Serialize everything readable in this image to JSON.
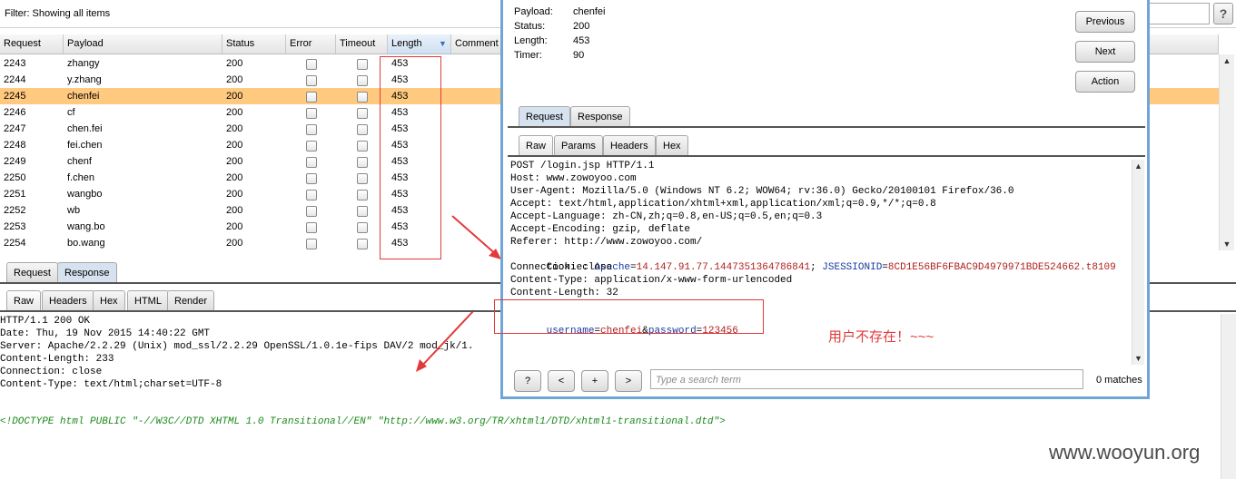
{
  "filter": {
    "label": "Filter: Showing all items",
    "help": "?"
  },
  "table": {
    "columns": [
      "Request",
      "Payload",
      "Status",
      "Error",
      "Timeout",
      "Length",
      "Comment"
    ],
    "sort_indicator": "▼",
    "rows": [
      {
        "request": "2243",
        "payload": "zhangy",
        "status": "200",
        "length": "453"
      },
      {
        "request": "2244",
        "payload": "y.zhang",
        "status": "200",
        "length": "453"
      },
      {
        "request": "2245",
        "payload": "chenfei",
        "status": "200",
        "length": "453",
        "selected": true
      },
      {
        "request": "2246",
        "payload": "cf",
        "status": "200",
        "length": "453"
      },
      {
        "request": "2247",
        "payload": "chen.fei",
        "status": "200",
        "length": "453"
      },
      {
        "request": "2248",
        "payload": "fei.chen",
        "status": "200",
        "length": "453"
      },
      {
        "request": "2249",
        "payload": "chenf",
        "status": "200",
        "length": "453"
      },
      {
        "request": "2250",
        "payload": "f.chen",
        "status": "200",
        "length": "453"
      },
      {
        "request": "2251",
        "payload": "wangbo",
        "status": "200",
        "length": "453"
      },
      {
        "request": "2252",
        "payload": "wb",
        "status": "200",
        "length": "453"
      },
      {
        "request": "2253",
        "payload": "wang.bo",
        "status": "200",
        "length": "453"
      },
      {
        "request": "2254",
        "payload": "bo.wang",
        "status": "200",
        "length": "453"
      }
    ]
  },
  "bottom_tabs": {
    "request": "Request",
    "response": "Response"
  },
  "view_tabs": {
    "raw": "Raw",
    "headers": "Headers",
    "hex": "Hex",
    "html": "HTML",
    "render": "Render"
  },
  "response_lines": [
    "HTTP/1.1 200 OK",
    "Date: Thu, 19 Nov 2015 14:40:22 GMT",
    "Server: Apache/2.2.29 (Unix) mod_ssl/2.2.29 OpenSSL/1.0.1e-fips DAV/2 mod_jk/1.",
    "Content-Length: 233",
    "Connection: close",
    "Content-Type: text/html;charset=UTF-8"
  ],
  "doctype_line": "<!DOCTYPE html PUBLIC \"-//W3C//DTD XHTML 1.0 Transitional//EN\" \"http://www.w3.org/TR/xhtml1/DTD/xhtml1-transitional.dtd\">",
  "popup": {
    "payload_label": "Payload:",
    "payload_value": "chenfei",
    "status_label": "Status:",
    "status_value": "200",
    "length_label": "Length:",
    "length_value": "453",
    "timer_label": "Timer:",
    "timer_value": "90",
    "buttons": {
      "previous": "Previous",
      "next": "Next",
      "action": "Action"
    },
    "tabs": {
      "request": "Request",
      "response": "Response"
    },
    "subtabs": {
      "raw": "Raw",
      "params": "Params",
      "headers": "Headers",
      "hex": "Hex"
    },
    "request_lines": [
      "POST /login.jsp HTTP/1.1",
      "Host: www.zowoyoo.com",
      "User-Agent: Mozilla/5.0 (Windows NT 6.2; WOW64; rv:36.0) Gecko/20100101 Firefox/36.0",
      "Accept: text/html,application/xhtml+xml,application/xml;q=0.9,*/*;q=0.8",
      "Accept-Language: zh-CN,zh;q=0.8,en-US;q=0.5,en;q=0.3",
      "Accept-Encoding: gzip, deflate",
      "Referer: http://www.zowoyoo.com/"
    ],
    "cookie": {
      "prefix": "Cookie: ",
      "apache_key": "Apache",
      "apache_val": "14.147.91.77.1447351364786841",
      "sep": "; ",
      "jsession_key": "JSESSIONID",
      "jsession_val": "8CD1E56BF6FBAC9D4979971BDE524662.t8109"
    },
    "request_lines_after": [
      "Connection: close",
      "Content-Type: application/x-www-form-urlencoded",
      "Content-Length: 32"
    ],
    "body": {
      "k1": "username",
      "v1": "chenfei",
      "amp": "&",
      "k2": "password",
      "v2": "123456"
    },
    "note": "用户不存在！~~~",
    "search": {
      "help": "?",
      "prev": "<",
      "add": "+",
      "next": ">",
      "placeholder": "Type a search term",
      "matches": "0 matches"
    }
  },
  "watermark": "www.wooyun.org",
  "colors": {
    "selected_row": "#ffc97f",
    "annotation_red": "#e23a3a",
    "popup_border": "#6fa6d6"
  }
}
